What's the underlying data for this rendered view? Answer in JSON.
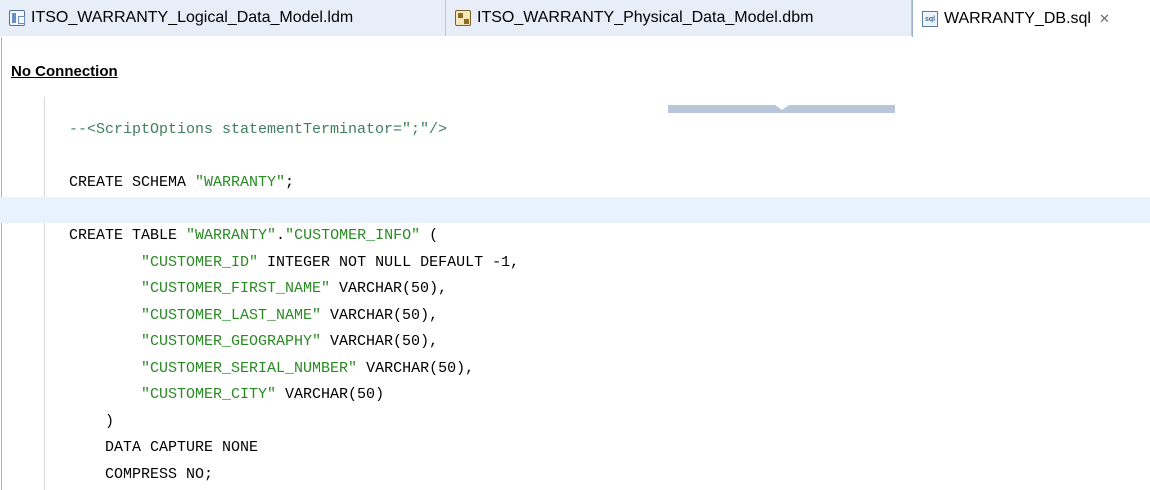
{
  "tabs": [
    {
      "icon": "logical-data-model-icon",
      "label": "ITSO_WARRANTY_Logical_Data_Model.ldm",
      "active": false
    },
    {
      "icon": "physical-data-model-icon",
      "label": "ITSO_WARRANTY_Physical_Data_Model.dbm",
      "active": false
    },
    {
      "icon": "sql-file-icon",
      "label": "WARRANTY_DB.sql",
      "active": true,
      "close": "✕"
    }
  ],
  "connection": {
    "label": "No Connection"
  },
  "code_lines": [
    [
      {
        "t": "--<ScriptOptions statementTerminator=\";\"/>",
        "s": "cmt"
      }
    ],
    [],
    [
      {
        "t": "CREATE SCHEMA ",
        "s": "kw"
      },
      {
        "t": "\"WARRANTY\"",
        "s": "str"
      },
      {
        "t": ";",
        "s": "kw"
      }
    ],
    [],
    [
      {
        "t": "CREATE TABLE ",
        "s": "kw"
      },
      {
        "t": "\"WARRANTY\"",
        "s": "str"
      },
      {
        "t": ".",
        "s": "kw"
      },
      {
        "t": "\"CUSTOMER_INFO\"",
        "s": "str"
      },
      {
        "t": " (",
        "s": "kw"
      }
    ],
    [
      {
        "t": "        ",
        "s": "kw"
      },
      {
        "t": "\"CUSTOMER_ID\"",
        "s": "str"
      },
      {
        "t": " INTEGER NOT NULL DEFAULT -1,",
        "s": "kw"
      }
    ],
    [
      {
        "t": "        ",
        "s": "kw"
      },
      {
        "t": "\"CUSTOMER_FIRST_NAME\"",
        "s": "str"
      },
      {
        "t": " VARCHAR(50),",
        "s": "kw"
      }
    ],
    [
      {
        "t": "        ",
        "s": "kw"
      },
      {
        "t": "\"CUSTOMER_LAST_NAME\"",
        "s": "str"
      },
      {
        "t": " VARCHAR(50),",
        "s": "kw"
      }
    ],
    [
      {
        "t": "        ",
        "s": "kw"
      },
      {
        "t": "\"CUSTOMER_GEOGRAPHY\"",
        "s": "str"
      },
      {
        "t": " VARCHAR(50),",
        "s": "kw"
      }
    ],
    [
      {
        "t": "        ",
        "s": "kw"
      },
      {
        "t": "\"CUSTOMER_SERIAL_NUMBER\"",
        "s": "str"
      },
      {
        "t": " VARCHAR(50),",
        "s": "kw"
      }
    ],
    [
      {
        "t": "        ",
        "s": "kw"
      },
      {
        "t": "\"CUSTOMER_CITY\"",
        "s": "str"
      },
      {
        "t": " VARCHAR(50)",
        "s": "kw"
      }
    ],
    [
      {
        "t": "    )",
        "s": "kw"
      }
    ],
    [
      {
        "t": "    DATA CAPTURE NONE",
        "s": "kw"
      }
    ],
    [
      {
        "t": "    COMPRESS NO;",
        "s": "kw"
      }
    ]
  ],
  "current_line": 3,
  "colors": {
    "string": "#2a8a24",
    "comment": "#3f7f5f",
    "current_line": "#e8f2fe"
  }
}
